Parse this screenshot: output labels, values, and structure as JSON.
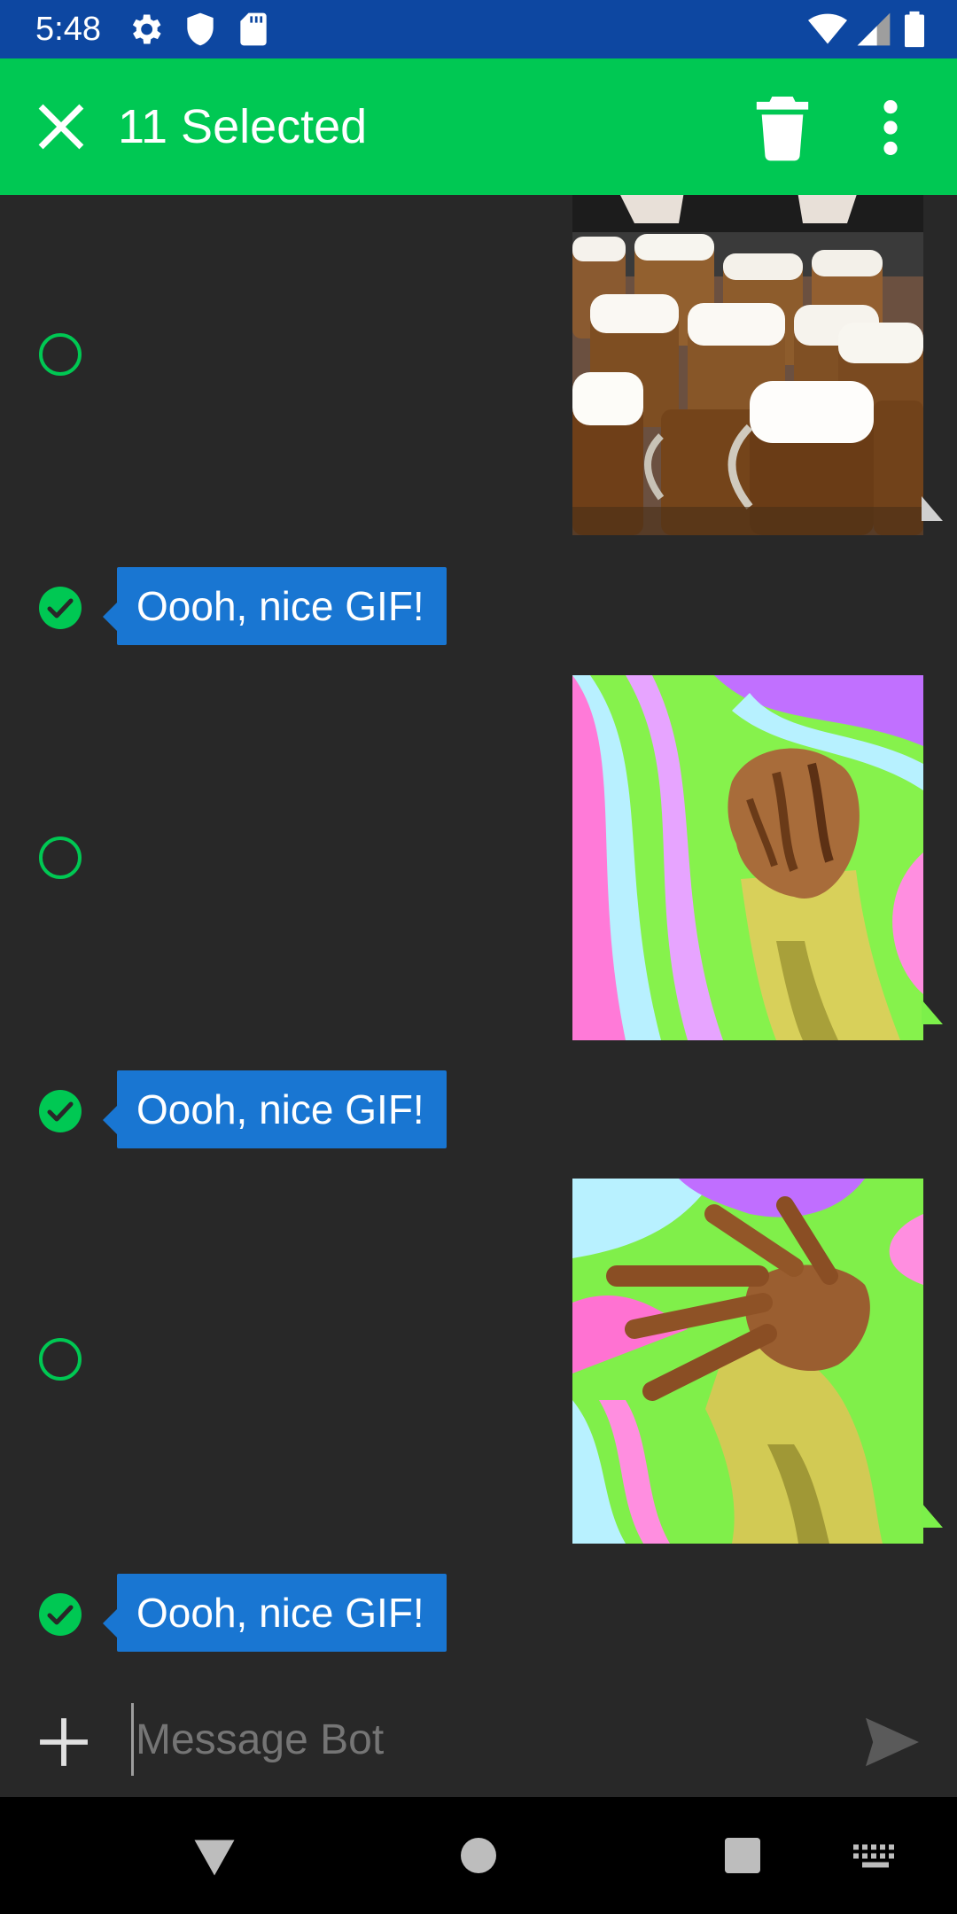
{
  "status_bar": {
    "time": "5:48",
    "left_icons": [
      "settings-icon",
      "shield-icon",
      "sd-card-icon"
    ],
    "right_icons": [
      "wifi-icon",
      "cell-signal-icon",
      "battery-icon"
    ]
  },
  "app_bar": {
    "title": "11 Selected",
    "background": "#00c853",
    "actions": [
      "close-icon",
      "trash-icon",
      "more-vert-icon"
    ]
  },
  "messages": [
    {
      "type": "gif",
      "sender": "bot",
      "selected": false,
      "subject": "beer mugs"
    },
    {
      "type": "text",
      "sender": "user",
      "selected": true,
      "text": "Oooh, nice GIF!"
    },
    {
      "type": "gif",
      "sender": "bot",
      "selected": false,
      "subject": "psychedelic banana hand"
    },
    {
      "type": "text",
      "sender": "user",
      "selected": true,
      "text": "Oooh, nice GIF!"
    },
    {
      "type": "gif",
      "sender": "bot",
      "selected": false,
      "subject": "psychedelic banana hand waving"
    },
    {
      "type": "text",
      "sender": "user",
      "selected": true,
      "text": "Oooh, nice GIF!"
    }
  ],
  "colors": {
    "status_bar": "#0d47a1",
    "accent": "#00c853",
    "bubble": "#1976d2",
    "background": "#282828"
  },
  "composer": {
    "placeholder": "Message Bot",
    "icons": [
      "add-icon",
      "send-icon"
    ]
  },
  "nav_bar": {
    "buttons": [
      "back-icon",
      "home-icon",
      "recents-icon",
      "keyboard-icon"
    ]
  }
}
